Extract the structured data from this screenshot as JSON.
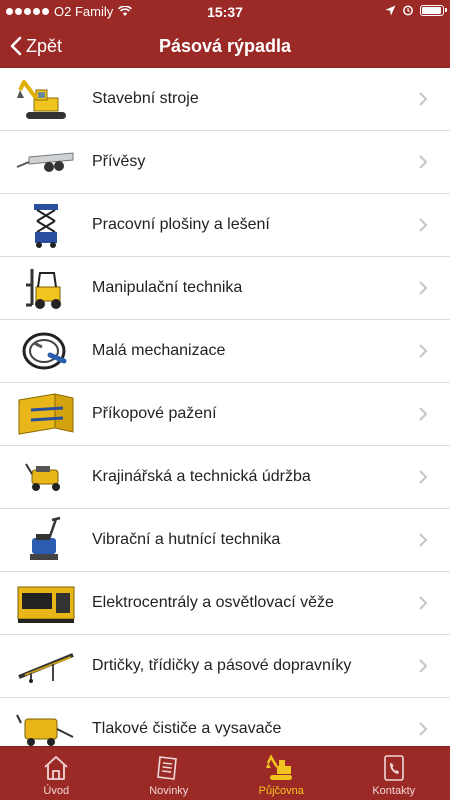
{
  "status_bar": {
    "carrier": "O2 Family",
    "time": "15:37"
  },
  "nav": {
    "back_label": "Zpět",
    "title": "Pásová rýpadla"
  },
  "list": {
    "items": [
      {
        "label": "Stavební stroje",
        "icon": "excavator"
      },
      {
        "label": "Přívěsy",
        "icon": "trailer"
      },
      {
        "label": "Pracovní plošiny a lešení",
        "icon": "scissor-lift"
      },
      {
        "label": "Manipulační technika",
        "icon": "forklift"
      },
      {
        "label": "Malá mechanizace",
        "icon": "cable-reel"
      },
      {
        "label": "Příkopové pažení",
        "icon": "trench-shoring"
      },
      {
        "label": "Krajinářská a technická údržba",
        "icon": "mower"
      },
      {
        "label": "Vibrační a hutnící technika",
        "icon": "plate-compactor"
      },
      {
        "label": "Elektrocentrály a osvětlovací věže",
        "icon": "generator"
      },
      {
        "label": "Drtičky, třídičky a pásové dopravníky",
        "icon": "conveyor"
      },
      {
        "label": "Tlakové čističe a vysavače",
        "icon": "pressure-washer"
      }
    ]
  },
  "tab_bar": {
    "tabs": [
      {
        "label": "Úvod",
        "icon": "home"
      },
      {
        "label": "Novinky",
        "icon": "news"
      },
      {
        "label": "Půjčovna",
        "icon": "excavator",
        "active": true
      },
      {
        "label": "Kontakty",
        "icon": "phone"
      }
    ]
  },
  "colors": {
    "brand": "#9b2a27",
    "active_tab": "#f2c420"
  }
}
